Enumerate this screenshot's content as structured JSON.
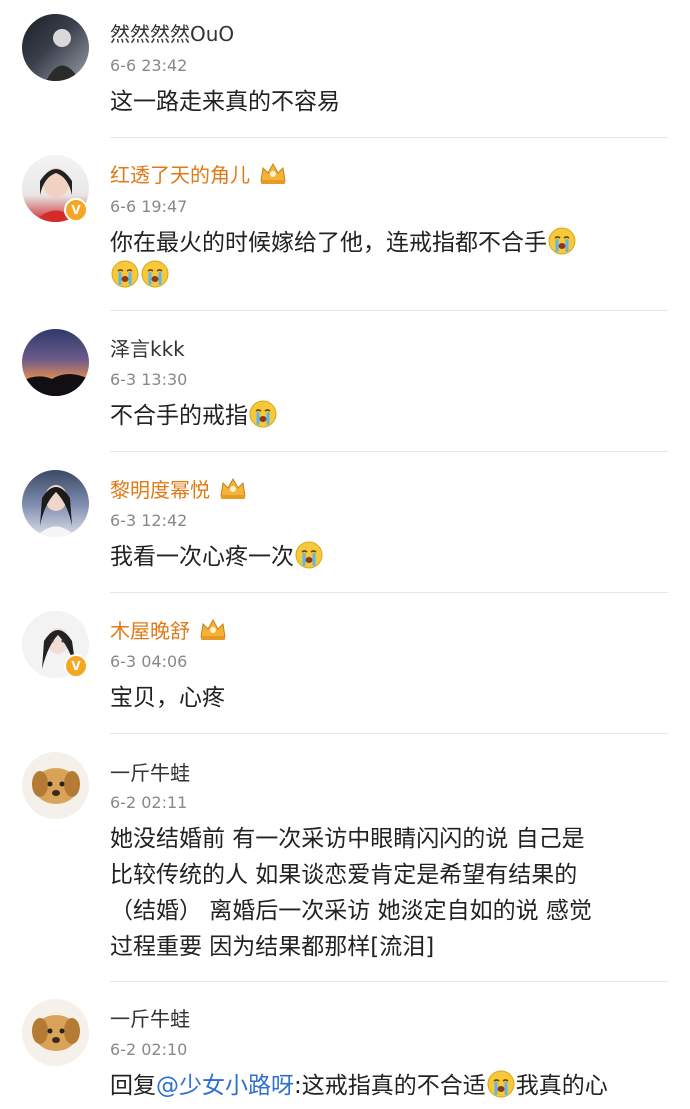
{
  "comments": [
    {
      "name": "然然然然OuO",
      "time": "6-6 23:42",
      "lines": [
        "这一路走来真的不容易"
      ]
    },
    {
      "name": "红透了天的角儿",
      "time": "6-6 19:47",
      "lines": [
        "你在最火的时候嫁给了他，连戒指都不合手"
      ]
    },
    {
      "name": "泽言kkk",
      "time": "6-3 13:30",
      "lines": [
        "不合手的戒指"
      ]
    },
    {
      "name": "黎明度幂悦",
      "time": "6-3 12:42",
      "lines": [
        "我看一次心疼一次"
      ]
    },
    {
      "name": "木屋晚舒",
      "time": "6-3 04:06",
      "lines": [
        "宝贝，心疼"
      ]
    },
    {
      "name": "一斤牛蛙",
      "time": "6-2 02:11",
      "lines": [
        "她没结婚前 有一次采访中眼睛闪闪的说 自己是",
        "比较传统的人 如果谈恋爱肯定是希望有结果的",
        "（结婚） 离婚后一次采访 她淡定自如的说 感觉",
        "过程重要 因为结果都那样[流泪]"
      ]
    },
    {
      "name": "一斤牛蛙",
      "time": "6-2 02:10",
      "reply_prefix": "回复",
      "mention": "@少女小路呀",
      "lines": [
        ":这戒指真的不合适",
        "我真的心"
      ]
    }
  ],
  "icons": {
    "crying": "crying-emoji-icon",
    "crown": "crown-badge-icon",
    "verified": "verified-badge-icon"
  },
  "colors": {
    "vip_name": "#e07a16",
    "mention": "#2e6fd1",
    "time": "#888888"
  }
}
